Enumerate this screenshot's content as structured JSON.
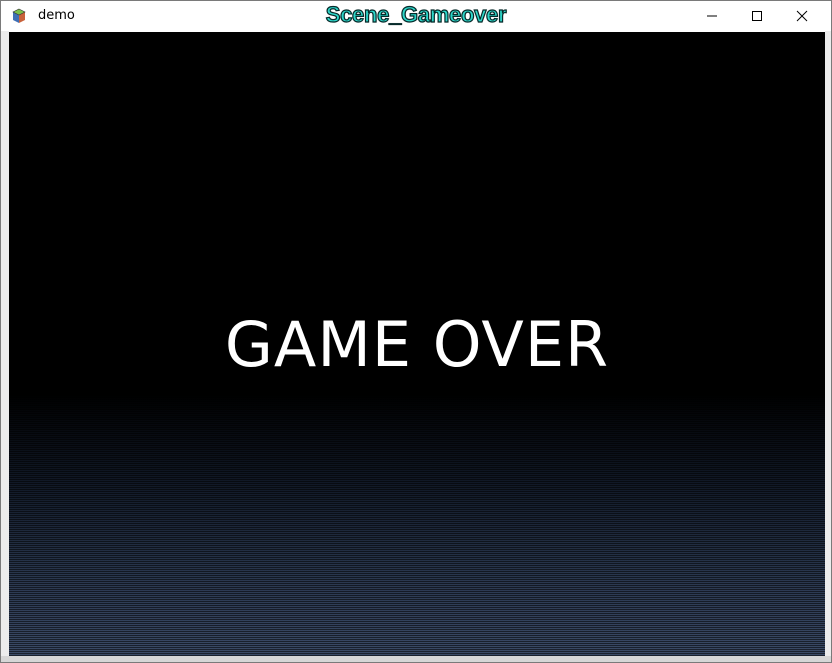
{
  "window": {
    "title": "demo",
    "scene_label": "Scene_Gameover",
    "controls": {
      "minimize": "minimize",
      "maximize": "maximize",
      "close": "close"
    }
  },
  "game": {
    "message": "GAME OVER"
  },
  "colors": {
    "scene_label": "#2dd6c9",
    "message": "#ffffff",
    "background_top": "#000000",
    "background_bottom": "#3a4a66"
  },
  "icons": {
    "app": "app-icon",
    "minimize": "minimize-icon",
    "maximize": "maximize-icon",
    "close": "close-icon"
  }
}
